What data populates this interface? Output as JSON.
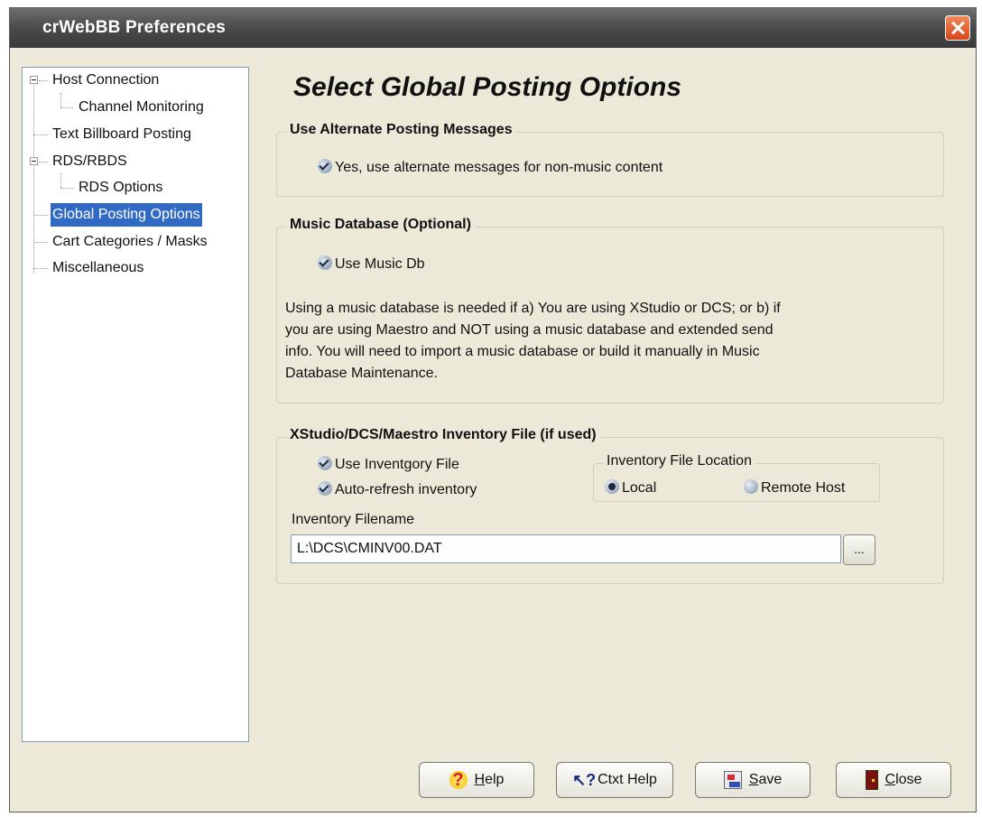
{
  "window": {
    "title": "crWebBB Preferences"
  },
  "tree": {
    "items": [
      {
        "label": "Host Connection"
      },
      {
        "label": "Channel Monitoring"
      },
      {
        "label": "Text Billboard Posting"
      },
      {
        "label": "RDS/RBDS"
      },
      {
        "label": "RDS Options"
      },
      {
        "label": "Global Posting Options",
        "selected": true
      },
      {
        "label": "Cart Categories / Masks"
      },
      {
        "label": "Miscellaneous"
      }
    ]
  },
  "main": {
    "heading": "Select Global Posting Options",
    "alt_group": {
      "legend": "Use Alternate Posting Messages",
      "checkbox_label": "Yes, use alternate messages for non-music content",
      "checked": true
    },
    "music_group": {
      "legend": "Music Database (Optional)",
      "checkbox_label": "Use Music Db",
      "checked": true,
      "lines": [
        "Using a music database is needed if a) You are using XStudio or DCS; or b) if",
        "you are using Maestro and NOT using a music database and extended send",
        "info. You will  need to import a music database or build it manually in Music",
        "Database Maintenance."
      ]
    },
    "inventory_group": {
      "legend": "XStudio/DCS/Maestro Inventory File (if used)",
      "use_file_label": "Use Inventgory File",
      "use_file_checked": true,
      "auto_refresh_label": "Auto-refresh inventory",
      "auto_refresh_checked": true,
      "location": {
        "legend": "Inventory File Location",
        "local_label": "Local",
        "remote_label": "Remote Host",
        "selected": "Local"
      },
      "filename_label": "Inventory Filename",
      "filename_value": "L:\\DCS\\CMINV00.DAT",
      "browse_label": "..."
    }
  },
  "buttons": {
    "help_label": "Help",
    "help_underline": "H",
    "help_rest": "elp",
    "ctxt_help_label": "Ctxt Help",
    "save_label": "Save",
    "save_underline": "S",
    "save_rest": "ave",
    "close_label": "Close",
    "close_underline": "C",
    "close_rest": "lose"
  },
  "colors": {
    "dialog_bg": "#ece9d8",
    "selection": "#316ac5",
    "titlebar": "#4a4a4a",
    "close_button": "#d8451c"
  },
  "icons": {
    "help": "question-mark-icon",
    "ctxt_help": "pointer-question-icon",
    "save": "save-icon",
    "close": "exit-door-icon"
  }
}
